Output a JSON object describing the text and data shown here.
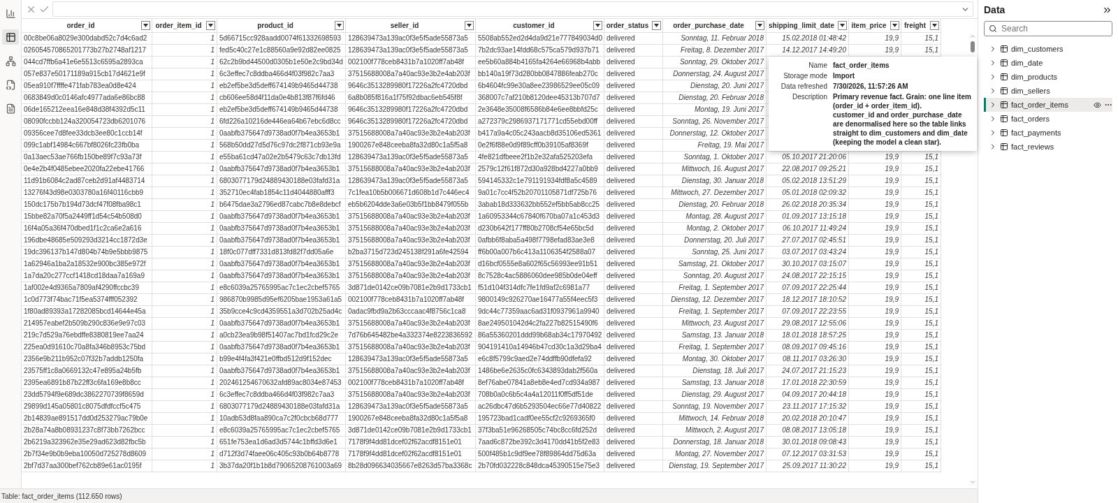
{
  "left_rail": [
    {
      "kind": "report",
      "selected": false
    },
    {
      "kind": "table",
      "selected": true
    },
    {
      "kind": "model",
      "selected": false
    },
    {
      "kind": "dax",
      "selected": false
    },
    {
      "kind": "tmdl",
      "selected": false
    }
  ],
  "table": {
    "columns": [
      {
        "label": "order_id",
        "kind": "text"
      },
      {
        "label": "order_item_id",
        "kind": "number"
      },
      {
        "label": "product_id",
        "kind": "text"
      },
      {
        "label": "seller_id",
        "kind": "text"
      },
      {
        "label": "customer_id",
        "kind": "text"
      },
      {
        "label": "order_status",
        "kind": "text"
      },
      {
        "label": "order_purchase_date",
        "kind": "number"
      },
      {
        "label": "shipping_limit_date",
        "kind": "number"
      },
      {
        "label": "item_price",
        "kind": "number"
      },
      {
        "label": "freight",
        "kind": "number"
      }
    ],
    "rows": [
      [
        "00c8be06a8029e300dabd52c7d4c6ad2",
        "1",
        "5d66715cc928aadd0074f61332698593",
        "128639473a139ac0f3e5f5ade55873a5",
        "5508ab552ed2d4da9d21e777849034d0",
        "delivered",
        "Sonntag, 11. Februar 2018",
        "15.02.2018 01:48:42",
        "19,9",
        "15,1"
      ],
      [
        "026054570865201773b27b2748af1217",
        "1",
        "fed5c40c27e1c88560a9e92d82ee0825",
        "128639473a139ac0f3e5f5ade55873a5",
        "7b2dc93ae14fdd68c575ca579d937b71",
        "delivered",
        "Freitag, 8. Dezember 2017",
        "14.12.2017 14:49:20",
        "19,9",
        "15,1"
      ],
      [
        "044cd7ffb6a41e6e5513c6595a2893ca",
        "1",
        "62c2b9bd44500d0305b1e50e2c9bd34d",
        "002100f778ceb8431b7a1020ff7ab48f",
        "ee5b60a884b4165fa4264e66968b4abb",
        "delivered",
        "Sonntag, 29. Oktober 2017",
        null,
        null,
        null
      ],
      [
        "057e837e50171189a915cb17d4621e9f",
        "1",
        "6c3effec7c8ddba466d4f03f982c7aa3",
        "37515688008a7a40ac93e3b2e4ab203f",
        "bb140a19f73d280bb0847886feab270c",
        "delivered",
        "Donnerstag, 24. August 2017",
        null,
        null,
        null
      ],
      [
        "05ea910f7ffffe471fab783ea0d8e424",
        "1",
        "eb2ef5be3d5deff674149b9465d44738",
        "9646c3513289980f17226a2fc4720dbd",
        "6b4604fc99e30a8ee23986529ee05c09",
        "delivered",
        "Dienstag, 20. Juni 2017",
        null,
        null,
        null
      ],
      [
        "0683849d0c0146afc4977ada6e86bc88",
        "1",
        "cb606ee58d4f11da0e4b813f87f6fd46",
        "6a8b085f816a1f75f92dbac6eb545f8f",
        "368007c7af210b8120dee45313b707d7",
        "delivered",
        "Dienstag, 20. Februar 2018",
        null,
        null,
        null
      ],
      [
        "06de165212eea16e848d38f4392d5c11",
        "1",
        "eb2ef5be3d5deff674149b9465d44738",
        "9646c3513289980f17226a2fc4720dbd",
        "2e3648e35008f6586b84e6ee8bbfd25c",
        "delivered",
        "Montag, 19. Juni 2017",
        null,
        null,
        null
      ],
      [
        "08090fccbb124a320054723db6201076",
        "1",
        "6fd226a10216de446ea64b67ebc6d8cc",
        "9646c3513289980f17226a2fc4720dbd",
        "a272379c2986937171771cd55ebd00ff",
        "delivered",
        "Sonntag, 26. November 2017",
        null,
        null,
        null
      ],
      [
        "09356cee7d8fee33dcb3ee80c1ccb14f",
        "1",
        "0aabfb375647d9738ad0f7b4ea3653b1",
        "37515688008a7a40ac93e3b2e4ab203f",
        "b417a9a4c05c243aacb8d35106ed5361",
        "delivered",
        "Donnerstag, 12. Oktober 2017",
        null,
        null,
        null
      ],
      [
        "099c1abf14984c667bf8026fc23fb0ba",
        "1",
        "568b50dd27d5d76c97dc2f871cb93e9a",
        "1900267e848ceeba8fa32d80c1a5f5a8",
        "0e2f6f88e0d9f89cff0b39105af8369f",
        "delivered",
        "Freitag, 19. Mai 2017",
        null,
        null,
        null
      ],
      [
        "0a13aec53ae766fb150be89f7c93a73f",
        "1",
        "e55ba61cd47a02e2b5479c63c7db13fd",
        "128639473a139ac0f3e5f5ade55873a5",
        "4fe821dfbeee2f1b2e32afa525203efa",
        "delivered",
        "Sonntag, 1. Oktober 2017",
        "05.10.2017 21:20:06",
        "19,9",
        "15,1"
      ],
      [
        "0e4e2b4f0485ebee2020fa22ebe41766",
        "1",
        "0aabfb375647d9738ad0f7b4ea3653b1",
        "37515688008a7a40ac93e3b2e4ab203f",
        "2579c12f61f872d30a928bd4227a0bb9",
        "delivered",
        "Mittwoch, 16. August 2017",
        "22.08.2017 09:25:21",
        "19,9",
        "15,1"
      ],
      [
        "11d91b6084c2ad87ceb2d91af4483714",
        "1",
        "6803077179d24889430188e03fafd31a",
        "128639473a139ac0f3e5f5ade55873a5",
        "594145332c1e791191934fdf8a5c4589",
        "delivered",
        "Dienstag, 30. Januar 2018",
        "05.02.2018 13:51:29",
        "19,9",
        "15,1"
      ],
      [
        "13276f43d98e0303780a16f40116cbb9",
        "1",
        "352710ec4fab1854c11d4044880afff3",
        "7c1fea10b5b006671d608b1d7c446ec4",
        "9a01c7cc4f52b20701105871df725b76",
        "delivered",
        "Mittwoch, 27. Dezember 2017",
        "05.01.2018 02:09:32",
        "19,9",
        "15,1"
      ],
      [
        "150dc175b7b194d73dcf47f08fba98c1",
        "1",
        "b6475dae3a2796ed87cabc7b8e8debcf",
        "eb5b6204dde3a6e03b5f1bb8479f055b",
        "3abab18d333632bb552ef5bb5ab8cc25",
        "delivered",
        "Dienstag, 20. Februar 2018",
        "26.02.2018 20:35:34",
        "19,9",
        "15,1"
      ],
      [
        "15bbe82a70f5a2449ff1d54c54b508d0",
        "1",
        "0aabfb375647d9738ad0f7b4ea3653b1",
        "37515688008a7a40ac93e3b2e4ab203f",
        "1a60953344c67840f670ba07a1c453d3",
        "delivered",
        "Montag, 28. August 2017",
        "01.09.2017 13:15:18",
        "19,9",
        "15,1"
      ],
      [
        "16f4a05a36f470dbed1f1c2ca6e2a616",
        "1",
        "0aabfb375647d9738ad0f7b4ea3653b1",
        "37515688008a7a40ac93e3b2e4ab203f",
        "d230b642f177ff80b2708cf54e65bc5d",
        "delivered",
        "Montag, 2. Oktober 2017",
        "06.10.2017 11:49:24",
        "19,9",
        "15,1"
      ],
      [
        "196dbe48685e509293d3214cc1872d3e",
        "1",
        "0aabfb375647d9738ad0f7b4ea3653b1",
        "37515688008a7a40ac93e3b2e4ab203f",
        "0afbb6f8aba5a498f7798efad83ae3e8",
        "delivered",
        "Donnerstag, 20. Juli 2017",
        "27.07.2017 02:45:51",
        "19,9",
        "15,1"
      ],
      [
        "19dc396137b147d804b74b9e5bbb9875",
        "1",
        "18f0c077dff7331d813fd82f7dd05a6e",
        "b2ba3715d723d245138f291a6fe42594",
        "ff6b00a007b6c413a1106354f2588a07",
        "delivered",
        "Sonntag, 25. Juni 2017",
        "03.07.2017 03:43:24",
        "19,9",
        "15,1"
      ],
      [
        "1a62946a1ba2a18532e900bc385e972f",
        "1",
        "0aabfb375647d9738ad0f7b4ea3653b1",
        "37515688008a7a40ac93e3b2e4ab203f",
        "d16bcf0555e8a602f65c56993ee91b51",
        "delivered",
        "Samstag, 21. Oktober 2017",
        "30.10.2017 03:15:07",
        "19,9",
        "15,1"
      ],
      [
        "1a7da20c277ccf1418cd18daa7a169a9",
        "1",
        "0aabfb375647d9738ad0f7b4ea3653b1",
        "37515688008a7a40ac93e3b2e4ab203f",
        "8c7528c4ac5886060dee985b0de04eff",
        "delivered",
        "Sonntag, 20. August 2017",
        "24.08.2017 22:15:15",
        "19,9",
        "15,1"
      ],
      [
        "1af002e4d9365a7809af4290ffccbc39",
        "1",
        "e8c6039a25765995ac7c1ec2cbef5765",
        "3d871de0142ce09b7081e2b9d1733cb1",
        "f51d104f314dfc7fe1fd9af2c6981a77",
        "delivered",
        "Freitag, 1. September 2017",
        "07.09.2017 22:25:44",
        "19,9",
        "15,1"
      ],
      [
        "1c0d773f74bac71f5ea5374fff052392",
        "1",
        "986870b9985d95ef6205bae1953a61a5",
        "002100f778ceb8431b7a1020ff7ab48f",
        "9800149c926270ae16477a55f4eec5f3",
        "delivered",
        "Dienstag, 12. Dezember 2017",
        "18.12.2017 18:10:52",
        "19,9",
        "15,1"
      ],
      [
        "1f80ad89393a17282085bcd14644e45a",
        "1",
        "35b9cce4c9cd4359551a3d702b25ad4c",
        "0adac9fbd9a2b63cccaac4f8756c1ca8",
        "9dc44c77359aac6ad31f0937961a9940",
        "delivered",
        "Freitag, 1. September 2017",
        "07.09.2017 22:23:55",
        "19,9",
        "15,1"
      ],
      [
        "214957eabef2b509b290c836e9e97c03",
        "1",
        "0aabfb375647d9738ad0f7b4ea3653b1",
        "37515688008a7a40ac93e3b2e4ab203f",
        "8ae249501042d4c2fa227b82515490f6",
        "delivered",
        "Mittwoch, 23. August 2017",
        "29.08.2017 12:55:06",
        "19,9",
        "15,1"
      ],
      [
        "219c7d529a76ebdffe8380819ee7aa24",
        "1",
        "a0cb23ea9b98f51407ac7bd1fcd29c2e",
        "7d76b645482be4a332374e8223836592",
        "86a55360201ddd99b68ab34c17970492",
        "delivered",
        "Samstag, 13. Januar 2018",
        "18.01.2018 18:57:25",
        "19,9",
        "15,1"
      ],
      [
        "225ea0d91610c70a8fa346b8953c75bd",
        "1",
        "0aabfb375647d9738ad0f7b4ea3653b1",
        "37515688008a7a40ac93e3b2e4ab203f",
        "904191410a14946b47cd30c1a3d29ba4",
        "delivered",
        "Freitag, 1. September 2017",
        "08.09.2017 09:45:16",
        "19,9",
        "15,1"
      ],
      [
        "2356e9b211b952c07f32b7addb1250fa",
        "1",
        "b99e4f4fa3f421e0ffbd512d9f152dec",
        "128639473a139ac0f3e5f5ade55873a5",
        "e6c8f5799c9aed2e74ddffb90dfefa92",
        "delivered",
        "Montag, 30. Oktober 2017",
        "08.11.2017 03:26:30",
        "19,9",
        "15,1"
      ],
      [
        "23575ff1c8a0669132c47e895a24b5fb",
        "1",
        "0aabfb375647d9738ad0f7b4ea3653b1",
        "37515688008a7a40ac93e3b2e4ab203f",
        "1486be6e2635c0fc6343893dab2f560a",
        "delivered",
        "Dienstag, 18. Juli 2017",
        "24.07.2017 21:15:23",
        "19,9",
        "15,1"
      ],
      [
        "2395ea6891b87b22ff3c6fa169e8b8cc",
        "1",
        "202461254670632afd89ac8034e87453",
        "002100f778ceb8431b7a1020ff7ab48f",
        "8ef76abe07841a8eb8e4ed7cd934a987",
        "delivered",
        "Samstag, 13. Januar 2018",
        "17.01.2018 22:30:59",
        "19,9",
        "15,1"
      ],
      [
        "23dd5794f9e689dc3862270739f8659d",
        "1",
        "6c3effec7c8ddba466d4f03f982c7aa3",
        "37515688008a7a40ac93e3b2e4ab203f",
        "708b0a0c6b5c4a4a12011f0ff5df51de",
        "delivered",
        "Dienstag, 29. August 2017",
        "04.09.2017 20:44:18",
        "19,9",
        "15,1"
      ],
      [
        "29899d145a05801c8075dfdfccf5c475",
        "1",
        "6803077179d24889430188e03fafd31a",
        "128639473a139ac0f3e5f5ade55873a5",
        "ac26dbc47d6b5293504ec66e77d40822",
        "delivered",
        "Sonntag, 19. November 2017",
        "23.11.2017 17:15:32",
        "19,9",
        "15,1"
      ],
      [
        "2b14839ae891517dd0d253279ac79b0e",
        "1",
        "10adb53d8faa890ca7c2f0cbcb68d777",
        "1900267e848ceeba8fa32d80c1a5f5a8",
        "195723bad1cadf0ee55cf2c9269365f0",
        "delivered",
        "Mittwoch, 14. Februar 2018",
        "20.02.2018 20:10:47",
        "19,9",
        "15,1"
      ],
      [
        "2b28a74a8b08931237c8f73bb7262bcc",
        "1",
        "e8c6039a25765995ac7c1ec2cbef5765",
        "3d871de0142ce09b7081e2b9d1733cb1",
        "37f3ba51e96268505c74bc8cc6fd252d",
        "delivered",
        "Mittwoch, 2. August 2017",
        "08.08.2017 13:05:18",
        "19,9",
        "15,1"
      ],
      [
        "2b6219a323962e35e29ad623d82fbc5b",
        "1",
        "651fe753ea1d6ad3d5744c1bffd3d6e1",
        "7178f9f4dd81dcef02f62acdf8151e01",
        "7aad6c872be392c3d4170dd41b5f2e83",
        "delivered",
        "Donnerstag, 18. Januar 2018",
        "30.01.2018 09:08:43",
        "19,9",
        "15,1"
      ],
      [
        "2b7f34e9b0b9eba10050d725278d8609",
        "1",
        "d712f3d74faee06c405c93b0b64b8778",
        "7178f9f4dd81dcef02f62acdf8151e01",
        "500f485b1c9df9ee78f89864dd75d63a",
        "delivered",
        "Montag, 27. November 2017",
        "07.12.2017 03:31:53",
        "19,9",
        "15,1"
      ],
      [
        "2bf7d37aa300bef762cb89e61ac0195f",
        "1",
        "3b37da20f1b1b8d79065208761003a69",
        "8b28d096634035667e8263d57ba3368c",
        "2b70fd032228c848dca45390515e75e3",
        "delivered",
        "Dienstag, 19. September 2017",
        "25.09.2017 11:30:22",
        "19,9",
        "15,1"
      ]
    ]
  },
  "tooltip": {
    "fields": [
      {
        "label": "Name",
        "value": "fact_order_items"
      },
      {
        "label": "Storage mode",
        "value": "Import"
      },
      {
        "label": "Data refreshed",
        "value": "7/30/2026, 11:57:26 AM"
      },
      {
        "label": "Description",
        "value": "Primary revenue fact. Grain: one line item (order_id + order_item_id).\ncustomer_id and order_purchase_date are denormalised here so the table links straight to dim_customers and dim_date (keeping the model a clean star)."
      }
    ]
  },
  "status_bar": "Table: fact_order_items (112.650 rows)",
  "data_pane": {
    "title": "Data",
    "search": {
      "placeholder": "Search"
    },
    "items": [
      {
        "label": "dim_customers",
        "selected": false,
        "expanded": false
      },
      {
        "label": "dim_date",
        "selected": false,
        "expanded": false
      },
      {
        "label": "dim_products",
        "selected": false,
        "expanded": false
      },
      {
        "label": "dim_sellers",
        "selected": false,
        "expanded": false
      },
      {
        "label": "fact_order_items",
        "selected": true,
        "expanded": false
      },
      {
        "label": "fact_orders",
        "selected": false,
        "expanded": false
      },
      {
        "label": "fact_payments",
        "selected": false,
        "expanded": false
      },
      {
        "label": "fact_reviews",
        "selected": false,
        "expanded": false
      }
    ]
  }
}
